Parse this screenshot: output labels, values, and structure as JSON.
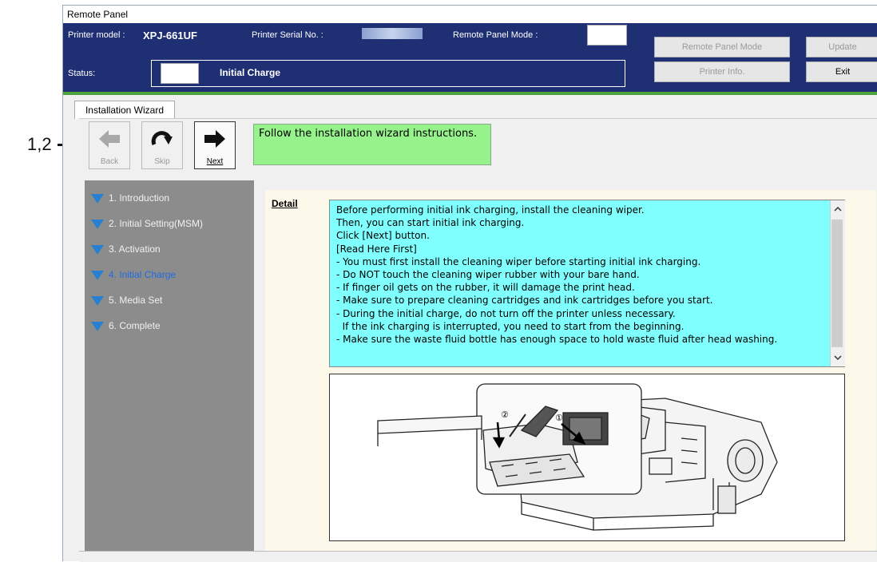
{
  "annotation": {
    "callout": "1,2"
  },
  "window": {
    "title": "Remote Panel"
  },
  "header": {
    "printer_model_label": "Printer model :",
    "printer_model_value": "XPJ-661UF",
    "serial_label": "Printer Serial No. :",
    "remote_mode_label": "Remote Panel Mode :",
    "status_label": "Status:",
    "status_value": "Initial Charge",
    "buttons": {
      "remote_panel_mode": "Remote Panel Mode",
      "update": "Update",
      "printer_info": "Printer Info.",
      "exit": "Exit"
    },
    "colors": {
      "header_bg": "#1f2f73",
      "accent_strip": "#4da33c"
    }
  },
  "tabs": [
    {
      "label": "Installation Wizard"
    }
  ],
  "toolbar": {
    "back_label": "Back",
    "skip_label": "Skip",
    "next_label": "Next",
    "instruction": "Follow the installation wizard instructions."
  },
  "steps": [
    {
      "label": "1. Introduction"
    },
    {
      "label": "2. Initial Setting(MSM)"
    },
    {
      "label": "3. Activation"
    },
    {
      "label": "4. Initial Charge",
      "current": true
    },
    {
      "label": "5. Media Set"
    },
    {
      "label": "6. Complete"
    }
  ],
  "detail": {
    "label": "Detail",
    "lines": [
      "Before performing initial ink charging, install the cleaning wiper.",
      "Then, you can start initial ink charging.",
      "Click [Next] button.",
      "[Read Here First]",
      "- You must first install the cleaning wiper before starting initial ink charging.",
      "- Do NOT touch the cleaning wiper rubber with your bare hand.",
      "- If finger oil gets on the rubber, it will damage the print head.",
      "- Make sure to prepare cleaning cartridges and ink cartridges before you start.",
      "- During the initial charge, do not turn off the printer unless necessary.",
      "  If the ink charging is interrupted, you need to start from the beginning.",
      "- Make sure the waste fluid bottle has enough space to hold waste fluid after head washing."
    ],
    "illustration_labels": [
      "②",
      "①"
    ]
  }
}
